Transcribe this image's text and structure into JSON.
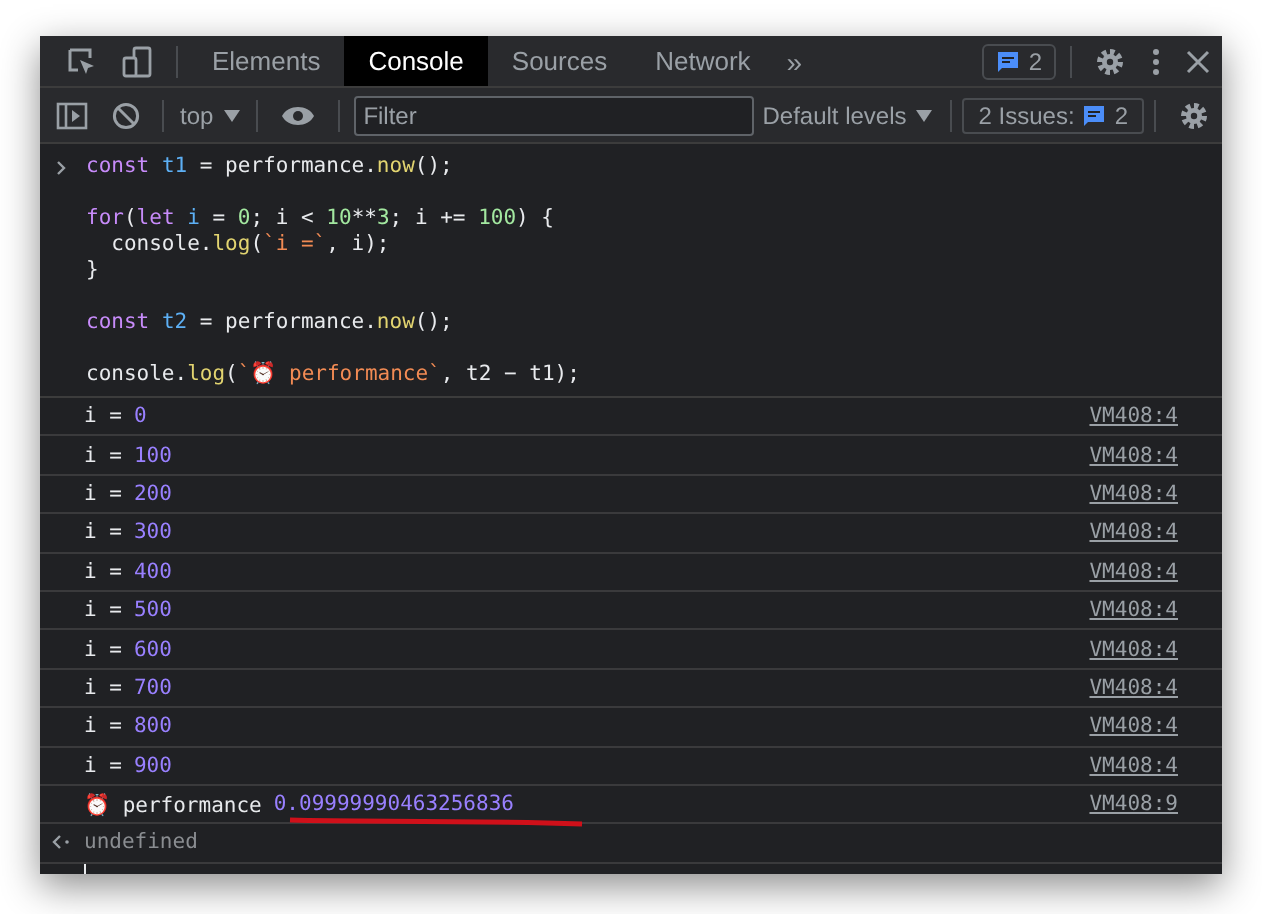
{
  "tabs": [
    {
      "label": "Elements",
      "selected": false
    },
    {
      "label": "Console",
      "selected": true
    },
    {
      "label": "Sources",
      "selected": false
    },
    {
      "label": "Network",
      "selected": false
    }
  ],
  "more_tabs": "»",
  "message_count": "2",
  "toolbar": {
    "context": "top",
    "filter_placeholder": "Filter",
    "levels": "Default levels",
    "issues_label": "2 Issues:",
    "issues_count": "2"
  },
  "code": [
    {
      "kind": "code",
      "tokens": [
        {
          "kind": "keyword",
          "s": "const "
        },
        {
          "kind": "variable",
          "s": "t1"
        },
        {
          "kind": "plain",
          "s": " = performance."
        },
        {
          "kind": "function",
          "s": "now"
        },
        {
          "kind": "plain",
          "s": "();"
        }
      ]
    },
    {
      "kind": "blank"
    },
    {
      "kind": "code",
      "tokens": [
        {
          "kind": "keyword",
          "s": "for"
        },
        {
          "kind": "plain",
          "s": "("
        },
        {
          "kind": "keyword",
          "s": "let "
        },
        {
          "kind": "variable",
          "s": "i"
        },
        {
          "kind": "plain",
          "s": " = "
        },
        {
          "kind": "number",
          "s": "0"
        },
        {
          "kind": "plain",
          "s": "; i < "
        },
        {
          "kind": "number",
          "s": "10"
        },
        {
          "kind": "plain",
          "s": "**"
        },
        {
          "kind": "number",
          "s": "3"
        },
        {
          "kind": "plain",
          "s": "; i += "
        },
        {
          "kind": "number",
          "s": "100"
        },
        {
          "kind": "plain",
          "s": ") {"
        }
      ]
    },
    {
      "kind": "code",
      "tokens": [
        {
          "kind": "plain",
          "s": "  console."
        },
        {
          "kind": "function",
          "s": "log"
        },
        {
          "kind": "plain",
          "s": "("
        },
        {
          "kind": "string",
          "s": "`i =`"
        },
        {
          "kind": "plain",
          "s": ", i);"
        }
      ]
    },
    {
      "kind": "code",
      "tokens": [
        {
          "kind": "plain",
          "s": "}"
        }
      ]
    },
    {
      "kind": "blank"
    },
    {
      "kind": "code",
      "tokens": [
        {
          "kind": "keyword",
          "s": "const "
        },
        {
          "kind": "variable",
          "s": "t2"
        },
        {
          "kind": "plain",
          "s": " = performance."
        },
        {
          "kind": "function",
          "s": "now"
        },
        {
          "kind": "plain",
          "s": "();"
        }
      ]
    },
    {
      "kind": "blank"
    },
    {
      "kind": "code",
      "tokens": [
        {
          "kind": "plain",
          "s": "console."
        },
        {
          "kind": "function",
          "s": "log"
        },
        {
          "kind": "plain",
          "s": "("
        },
        {
          "kind": "string",
          "s": "`⏰ performance`"
        },
        {
          "kind": "plain",
          "s": ", t2 − t1);"
        }
      ]
    }
  ],
  "logs": [
    {
      "label": "i =",
      "value": "0",
      "source": "VM408:4"
    },
    {
      "label": "i =",
      "value": "100",
      "source": "VM408:4"
    },
    {
      "label": "i =",
      "value": "200",
      "source": "VM408:4"
    },
    {
      "label": "i =",
      "value": "300",
      "source": "VM408:4"
    },
    {
      "label": "i =",
      "value": "400",
      "source": "VM408:4"
    },
    {
      "label": "i =",
      "value": "500",
      "source": "VM408:4"
    },
    {
      "label": "i =",
      "value": "600",
      "source": "VM408:4"
    },
    {
      "label": "i =",
      "value": "700",
      "source": "VM408:4"
    },
    {
      "label": "i =",
      "value": "800",
      "source": "VM408:4"
    },
    {
      "label": "i =",
      "value": "900",
      "source": "VM408:4"
    },
    {
      "label": "⏰ performance",
      "value": "0.09999990463256836",
      "source": "VM408:9",
      "underlined": true
    }
  ],
  "result": "undefined"
}
